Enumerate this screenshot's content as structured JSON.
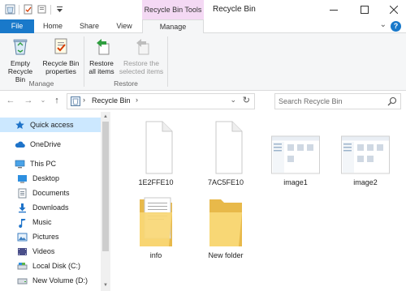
{
  "window": {
    "title": "Recycle Bin",
    "context_tab": "Recycle Bin Tools",
    "controls": [
      "minimize",
      "maximize",
      "close"
    ]
  },
  "ribbon_tabs": [
    "File",
    "Home",
    "Share",
    "View",
    "Manage"
  ],
  "ribbon": {
    "groups": [
      {
        "label": "Manage",
        "buttons": [
          {
            "label_line1": "Empty",
            "label_line2": "Recycle Bin",
            "icon": "empty-recycle-bin-icon",
            "enabled": true
          },
          {
            "label_line1": "Recycle Bin",
            "label_line2": "properties",
            "icon": "properties-icon",
            "enabled": true
          }
        ]
      },
      {
        "label": "Restore",
        "buttons": [
          {
            "label_line1": "Restore",
            "label_line2": "all items",
            "icon": "restore-all-icon",
            "enabled": true
          },
          {
            "label_line1": "Restore the",
            "label_line2": "selected items",
            "icon": "restore-selected-icon",
            "enabled": false
          }
        ]
      }
    ]
  },
  "address": {
    "breadcrumb": "Recycle Bin",
    "search_placeholder": "Search Recycle Bin"
  },
  "sidebar": {
    "items": [
      {
        "label": "Quick access",
        "icon": "star-icon",
        "selected": true
      },
      {
        "label": "OneDrive",
        "icon": "cloud-icon",
        "selected": false
      },
      {
        "label": "This PC",
        "icon": "computer-icon",
        "selected": false
      },
      {
        "label": "Desktop",
        "icon": "desktop-folder-icon",
        "selected": false
      },
      {
        "label": "Documents",
        "icon": "documents-folder-icon",
        "selected": false
      },
      {
        "label": "Downloads",
        "icon": "downloads-folder-icon",
        "selected": false
      },
      {
        "label": "Music",
        "icon": "music-folder-icon",
        "selected": false
      },
      {
        "label": "Pictures",
        "icon": "pictures-folder-icon",
        "selected": false
      },
      {
        "label": "Videos",
        "icon": "videos-folder-icon",
        "selected": false
      },
      {
        "label": "Local Disk (C:)",
        "icon": "drive-icon",
        "selected": false
      },
      {
        "label": "New Volume (D:)",
        "icon": "drive-icon",
        "selected": false
      }
    ]
  },
  "files": [
    {
      "name": "1E2FFE10",
      "type": "blank-file"
    },
    {
      "name": "7AC5FE10",
      "type": "blank-file"
    },
    {
      "name": "image1",
      "type": "screenshot-image"
    },
    {
      "name": "image2",
      "type": "screenshot-image"
    },
    {
      "name": "info",
      "type": "folder-with-docs"
    },
    {
      "name": "New folder",
      "type": "folder"
    }
  ],
  "colors": {
    "file_tab": "#1979ca",
    "context_tab": "#f4d9f4",
    "selected_nav": "#cce8ff",
    "ribbon_bg": "#f5f6f7",
    "folder_yellow": "#f8d775"
  }
}
